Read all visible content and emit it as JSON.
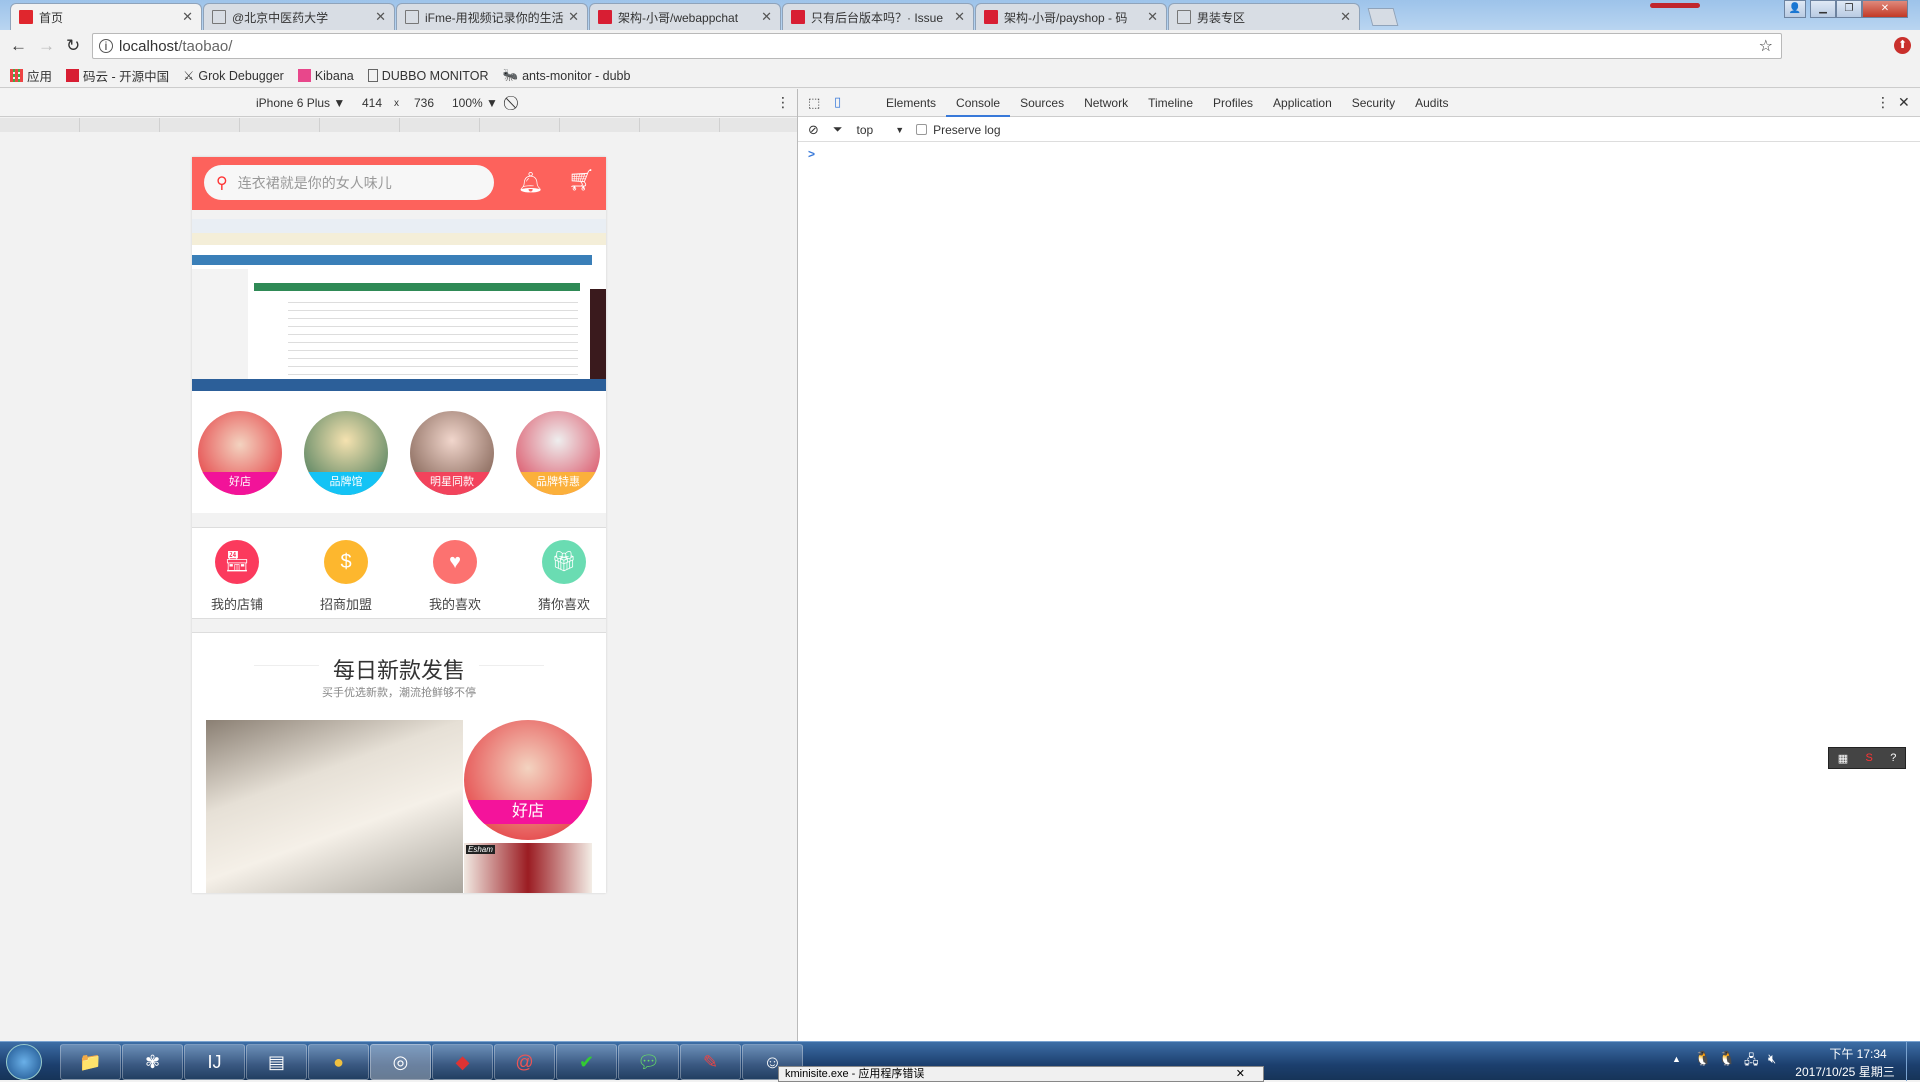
{
  "browser": {
    "tabs": [
      {
        "title": "首页",
        "favicon": "#e0262d",
        "active": true
      },
      {
        "title": "@北京中医药大学",
        "favicon": "page"
      },
      {
        "title": "iFme-用视频记录你的生活",
        "favicon": "page"
      },
      {
        "title": "架构-小哥/webappchat",
        "favicon": "#d81e33"
      },
      {
        "title": "只有后台版本吗？· Issue",
        "favicon": "#d81e33"
      },
      {
        "title": "架构-小哥/payshop - 码",
        "favicon": "#d81e33"
      },
      {
        "title": "男装专区",
        "favicon": "page"
      }
    ],
    "url_host": "localhost",
    "url_path": "/taobao/",
    "bookmarks": [
      {
        "label": "应用",
        "icon": "apps-grid-icon"
      },
      {
        "label": "码云 - 开源中国",
        "icon": "gitee-icon"
      },
      {
        "label": "Grok Debugger",
        "icon": "grok-icon"
      },
      {
        "label": "Kibana",
        "icon": "kibana-icon"
      },
      {
        "label": "DUBBO MONITOR",
        "icon": "page-icon"
      },
      {
        "label": "ants-monitor - dubb",
        "icon": "ants-icon"
      }
    ]
  },
  "device": {
    "name": "iPhone 6 Plus",
    "width": "414",
    "x": "x",
    "height": "736",
    "zoom": "100%"
  },
  "phone": {
    "search_placeholder": "连衣裙就是你的女人味儿",
    "circles": [
      {
        "label": "好店",
        "color": "#f21399"
      },
      {
        "label": "品牌馆",
        "color": "#14c3f5"
      },
      {
        "label": "明星同款",
        "color": "#f2435c"
      },
      {
        "label": "品牌特惠",
        "color": "#fbb03b"
      }
    ],
    "shortcuts": [
      {
        "label": "我的店铺",
        "color": "#fb3a5d",
        "icon": "shop-icon"
      },
      {
        "label": "招商加盟",
        "color": "#fdb72e",
        "icon": "money-bag-icon"
      },
      {
        "label": "我的喜欢",
        "color": "#fc7270",
        "icon": "heart-icon"
      },
      {
        "label": "猜你喜欢",
        "color": "#6adcb2",
        "icon": "gift-icon"
      }
    ],
    "section_title": "每日新款发售",
    "section_subtitle": "买手优选新款，潮流抢鲜够不停",
    "promo_label": "好店",
    "promo_brand": "Esham"
  },
  "devtools": {
    "tabs": [
      "Elements",
      "Console",
      "Sources",
      "Network",
      "Timeline",
      "Profiles",
      "Application",
      "Security",
      "Audits"
    ],
    "active_tab": "Console",
    "context": "top",
    "preserve_log": "Preserve log",
    "prompt": ">"
  },
  "taskbar": {
    "apps": [
      "explorer",
      "pinwheel",
      "intellij",
      "window",
      "app",
      "chrome",
      "redis",
      "swirl",
      "green",
      "wechat",
      "notes",
      "qq-user"
    ],
    "tooltip": "kminisite.exe - 应用程序错误",
    "time": "下午 17:34",
    "date": "2017/10/25 星期三"
  }
}
